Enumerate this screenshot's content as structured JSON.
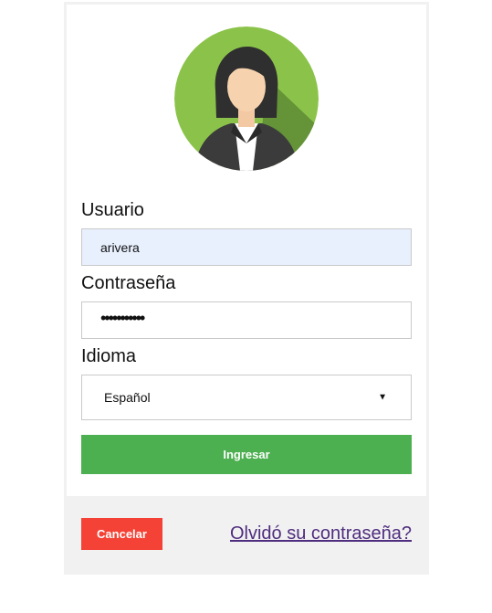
{
  "form": {
    "username_label": "Usuario",
    "username_value": "arivera",
    "password_label": "Contraseña",
    "password_masked": "•••••••••••",
    "language_label": "Idioma",
    "language_selected": "Español",
    "login_button": "Ingresar"
  },
  "footer": {
    "cancel_button": "Cancelar",
    "forgot_password_link": "Olvidó su contraseña?"
  },
  "colors": {
    "login_button": "#4caf50",
    "cancel_button": "#f44336",
    "avatar_background": "#8bc34a",
    "autofill_background": "#e8f0fe",
    "link": "#4f2d7f"
  },
  "icons": {
    "avatar": "user-avatar-icon",
    "select_caret": "caret-down-icon"
  }
}
